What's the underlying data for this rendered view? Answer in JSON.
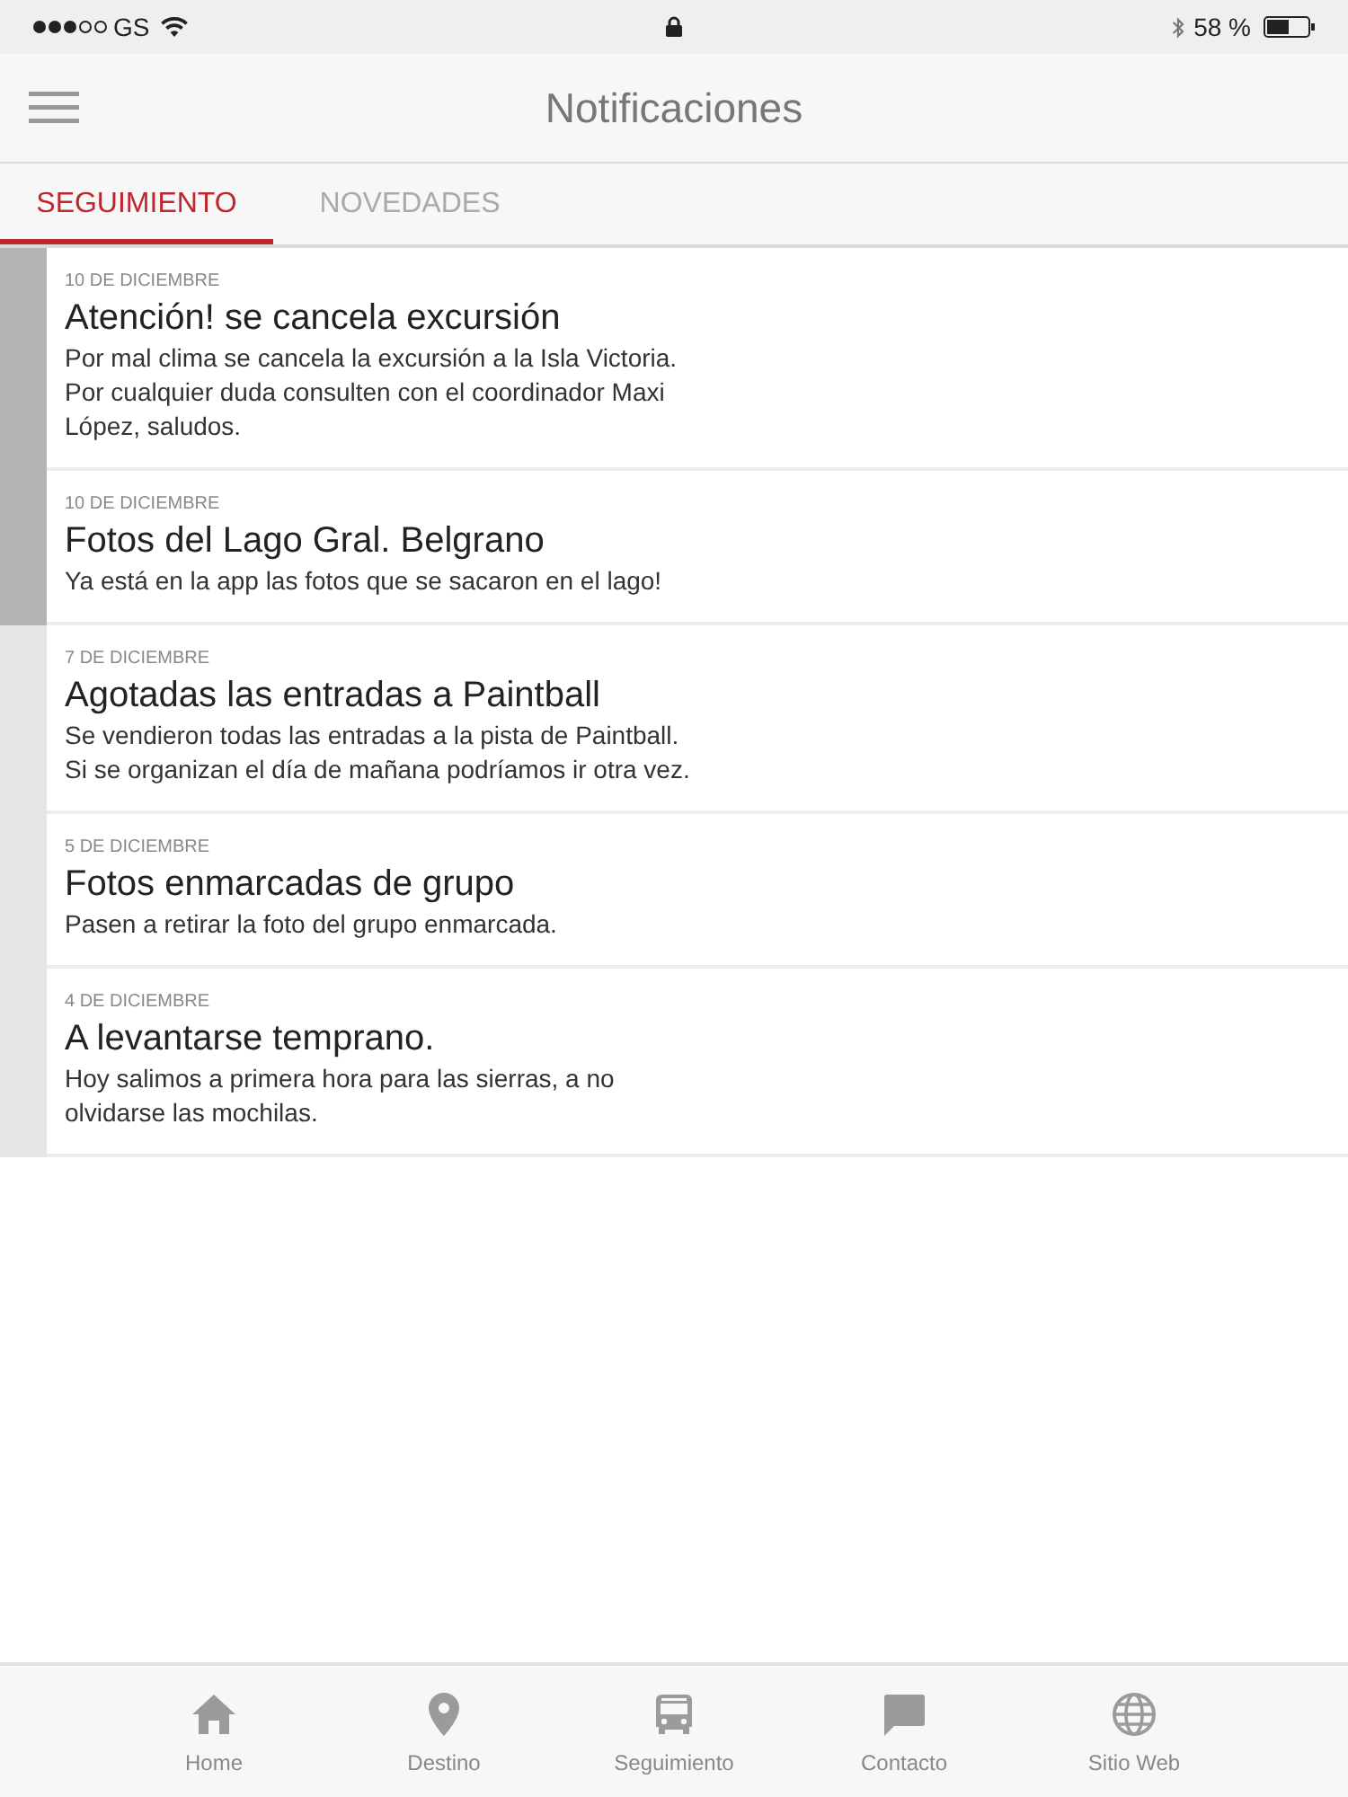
{
  "status_bar": {
    "carrier": "GS",
    "battery": "58 %"
  },
  "header": {
    "title": "Notificaciones"
  },
  "tabs": [
    {
      "label": "SEGUIMIENTO",
      "selected": true
    },
    {
      "label": "NOVEDADES",
      "selected": false
    }
  ],
  "notifications": [
    {
      "date": "10 DE DICIEMBRE",
      "title": "Atención! se cancela excursión",
      "body": "Por mal clima se cancela la excursión a la Isla Victoria.\nPor cualquier duda consulten con el coordinador Maxi\nLópez, saludos.",
      "unread": true
    },
    {
      "date": "10 DE DICIEMBRE",
      "title": "Fotos del Lago Gral. Belgrano",
      "body": "Ya está en la app las fotos que se sacaron en el lago!",
      "unread": true
    },
    {
      "date": "7 DE DICIEMBRE",
      "title": "Agotadas las entradas a Paintball",
      "body": "Se vendieron todas las entradas a la pista de Paintball.\nSi se organizan el día de mañana podríamos ir otra vez.",
      "unread": false
    },
    {
      "date": "5 DE DICIEMBRE",
      "title": "Fotos enmarcadas de grupo",
      "body": "Pasen a retirar la foto del grupo enmarcada.",
      "unread": false
    },
    {
      "date": "4 DE DICIEMBRE",
      "title": "A levantarse temprano.",
      "body": "Hoy salimos a primera hora para las sierras, a no\nolvidarse las mochilas.",
      "unread": false
    }
  ],
  "bottom_nav": [
    {
      "label": "Home",
      "kind": "home",
      "selected": false
    },
    {
      "label": "Destino",
      "kind": "pin",
      "selected": false
    },
    {
      "label": "Seguimiento",
      "kind": "bus",
      "selected": false
    },
    {
      "label": "Contacto",
      "kind": "chat",
      "selected": false
    },
    {
      "label": "Sitio Web",
      "kind": "globe",
      "selected": false
    }
  ]
}
